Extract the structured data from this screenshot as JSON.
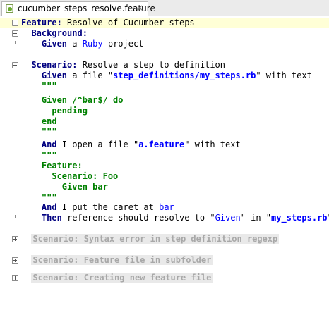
{
  "tab": {
    "label": "cucumber_steps_resolve.feature",
    "close_glyph": "×",
    "icon": "cucumber-feature-icon"
  },
  "editor": {
    "l1": {
      "kw": "Feature:",
      "rest": " Resolve of Cucumber steps"
    },
    "l2": {
      "kw": "Background:"
    },
    "l3": {
      "kw": "Given",
      "t1": " a ",
      "link": "Ruby",
      "t2": " project"
    },
    "l5": {
      "kw": "Scenario:",
      "rest": " Resolve a step to definition"
    },
    "l6": {
      "kw": "Given",
      "t1": " a file \"",
      "link": "step_definitions/my_steps.rb",
      "t2": "\" with text"
    },
    "l7": {
      "text": "\"\"\""
    },
    "l8": {
      "text": "Given /^bar$/ do"
    },
    "l9": {
      "text": "pending"
    },
    "l10": {
      "text": "end"
    },
    "l11": {
      "text": "\"\"\""
    },
    "l12": {
      "kw": "And",
      "t1": " I open a file \"",
      "link": "a.feature",
      "t2": "\" with text"
    },
    "l13": {
      "text": "\"\"\""
    },
    "l14": {
      "text": "Feature:"
    },
    "l15": {
      "text": "Scenario: Foo"
    },
    "l16": {
      "text": "Given bar"
    },
    "l17": {
      "text": "\"\"\""
    },
    "l18": {
      "kw": "And",
      "t1": " I put the caret at ",
      "link": "bar"
    },
    "l19": {
      "kw": "Then",
      "t1": " reference should resolve to \"",
      "link": "Given",
      "t2": "\" in \"",
      "link2": "my_steps.rb",
      "t3": "\""
    },
    "folded1": "Scenario: Syntax error in step definition regexp",
    "folded2": "Scenario: Feature file in subfolder",
    "folded3": "Scenario: Creating new feature file"
  },
  "colors": {
    "keyword": "#000080",
    "docstring": "#008000",
    "link": "#0000ff",
    "current_line": "#ffffd6",
    "folded_text": "#a8a8a8"
  }
}
